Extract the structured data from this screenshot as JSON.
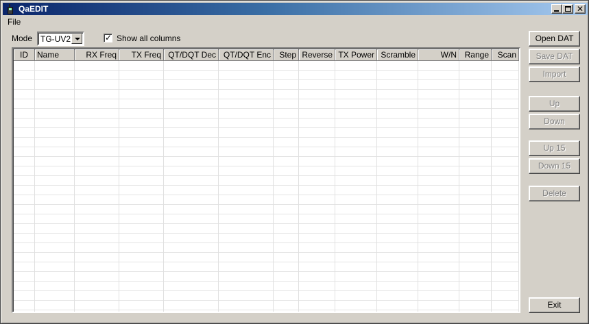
{
  "window": {
    "title": "QaEDIT",
    "title_icon": "radio-handset-icon",
    "controls": [
      "minimize-icon",
      "maximize-icon",
      "close-icon"
    ]
  },
  "menu": {
    "items": [
      {
        "label": "File"
      }
    ]
  },
  "toolbar": {
    "mode_label": "Mode",
    "mode_value": "TG-UV2",
    "show_all_label": "Show all columns",
    "show_all_checked": true
  },
  "grid": {
    "columns": [
      {
        "label": "ID"
      },
      {
        "label": "Name"
      },
      {
        "label": "RX Freq"
      },
      {
        "label": "TX Freq"
      },
      {
        "label": "QT/DQT Dec"
      },
      {
        "label": "QT/DQT Enc"
      },
      {
        "label": "Step"
      },
      {
        "label": "Reverse"
      },
      {
        "label": "TX Power"
      },
      {
        "label": "Scramble"
      },
      {
        "label": "W/N"
      },
      {
        "label": "Range"
      },
      {
        "label": "Scan"
      }
    ],
    "rows": []
  },
  "buttons": {
    "open_dat": "Open DAT",
    "save_dat": "Save DAT",
    "import": "Import",
    "up": "Up",
    "down": "Down",
    "up15": "Up 15",
    "down15": "Down 15",
    "delete": "Delete",
    "exit": "Exit"
  },
  "colors": {
    "title_start": "#0a246a",
    "title_end": "#a6caf0",
    "face": "#d4d0c8",
    "disabled_text": "#808080"
  }
}
